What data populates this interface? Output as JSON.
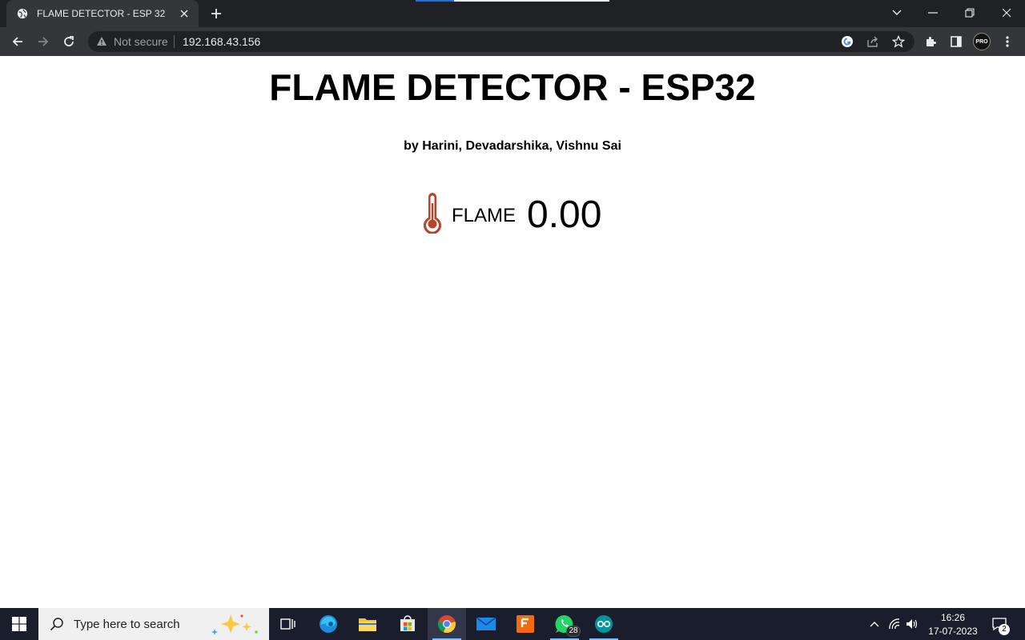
{
  "browser": {
    "tab": {
      "title": "FLAME DETECTOR - ESP 32"
    },
    "address": {
      "security_text": "Not secure",
      "url": "192.168.43.156"
    },
    "profile_badge": "PRO"
  },
  "page": {
    "title": "FLAME DETECTOR - ESP32",
    "subtitle": "by Harini, Devadarshika, Vishnu Sai",
    "reading": {
      "label": "FLAME",
      "value": "0.00",
      "icon": "thermometer-icon",
      "icon_color": "#b8452b"
    }
  },
  "taskbar": {
    "search_placeholder": "Type here to search",
    "whatsapp_badge": "28",
    "time": "16:26",
    "date": "17-07-2023",
    "notifications_count": "2"
  },
  "colors": {
    "chrome_dark": "#202124",
    "chrome_toolbar": "#35363a",
    "taskbar_bg": "#1a1d2b",
    "active_indicator": "#7cc0ff"
  }
}
